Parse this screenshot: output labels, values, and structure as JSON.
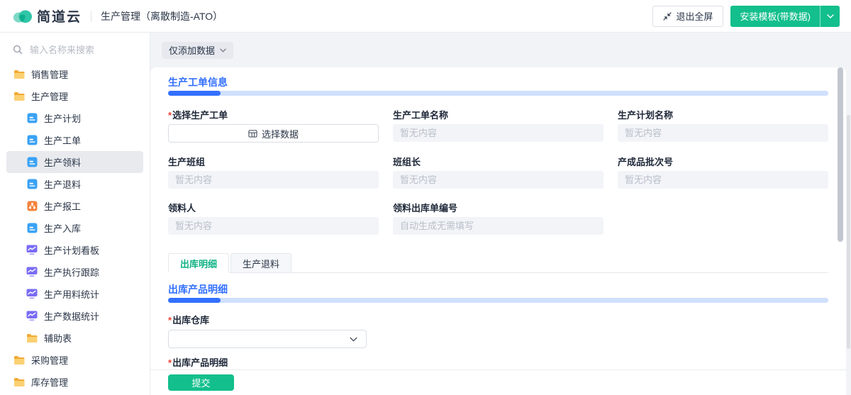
{
  "header": {
    "logo_text": "简道云",
    "app_title": "生产管理（离散制造-ATO）",
    "exit_fullscreen": "退出全屏",
    "install_template": "安装模板(带数据)"
  },
  "sidebar": {
    "search_placeholder": "输入名称来搜索",
    "items": [
      {
        "label": "销售管理",
        "icon": "folder-icon",
        "level": 0,
        "selected": false
      },
      {
        "label": "生产管理",
        "icon": "folder-icon",
        "level": 0,
        "selected": false
      },
      {
        "label": "生产计划",
        "icon": "form-icon",
        "level": 1,
        "selected": false
      },
      {
        "label": "生产工单",
        "icon": "form-icon",
        "level": 1,
        "selected": false
      },
      {
        "label": "生产领料",
        "icon": "form-icon",
        "level": 1,
        "selected": true
      },
      {
        "label": "生产退料",
        "icon": "form-icon",
        "level": 1,
        "selected": false
      },
      {
        "label": "生产报工",
        "icon": "report-icon",
        "level": 1,
        "selected": false
      },
      {
        "label": "生产入库",
        "icon": "form-icon",
        "level": 1,
        "selected": false
      },
      {
        "label": "生产计划看板",
        "icon": "dashboard-icon",
        "level": 1,
        "selected": false
      },
      {
        "label": "生产执行跟踪",
        "icon": "dashboard-icon",
        "level": 1,
        "selected": false
      },
      {
        "label": "生产用料统计",
        "icon": "dashboard-icon",
        "level": 1,
        "selected": false
      },
      {
        "label": "生产数据统计",
        "icon": "dashboard-icon",
        "level": 1,
        "selected": false
      },
      {
        "label": "辅助表",
        "icon": "folder-icon",
        "level": 1,
        "selected": false
      },
      {
        "label": "采购管理",
        "icon": "folder-icon",
        "level": 0,
        "selected": false
      },
      {
        "label": "库存管理",
        "icon": "folder-icon",
        "level": 0,
        "selected": false
      }
    ]
  },
  "toolbar": {
    "mode_button": "仅添加数据"
  },
  "form": {
    "section1_title": "生产工单信息",
    "fields": {
      "select_work_order": {
        "label": "选择生产工单",
        "required": true,
        "button": "选择数据"
      },
      "work_order_name": {
        "label": "生产工单名称",
        "placeholder": "暂无内容"
      },
      "plan_name": {
        "label": "生产计划名称",
        "placeholder": "暂无内容"
      },
      "team": {
        "label": "生产班组",
        "placeholder": "暂无内容"
      },
      "team_leader": {
        "label": "班组长",
        "placeholder": "暂无内容"
      },
      "batch_no": {
        "label": "产成品批次号",
        "placeholder": "暂无内容"
      },
      "picker": {
        "label": "领料人",
        "placeholder": "暂无内容"
      },
      "outbound_no": {
        "label": "领料出库单编号",
        "placeholder": "自动生成无需填写"
      }
    },
    "tabs": [
      {
        "label": "出库明细",
        "active": true
      },
      {
        "label": "生产退料",
        "active": false
      }
    ],
    "section2_title": "出库产品明细",
    "warehouse": {
      "label": "出库仓库",
      "required": true,
      "value": ""
    },
    "detail_label": "出库产品明细",
    "submit": "提交"
  },
  "icons": {
    "logo": "jiandaoyun-cloud-heart",
    "search": "magnifier",
    "exit_fullscreen": "compress-arrows",
    "dropdown": "chevron-down",
    "folder": "folder",
    "form": "form-document",
    "report": "report-flowchart",
    "dashboard": "chart-monitor",
    "select_data": "data-table"
  },
  "colors": {
    "brand_green": "#13bf8c",
    "accent_blue": "#3370ff",
    "progress_track": "#cfe0fd",
    "folder_yellow": "#f7ba42",
    "form_blue": "#3aa2f5",
    "report_orange": "#f5823c",
    "dashboard_purple": "#7a6cf5",
    "required_red": "#f04134",
    "selected_item_bg": "#e8eaee"
  }
}
